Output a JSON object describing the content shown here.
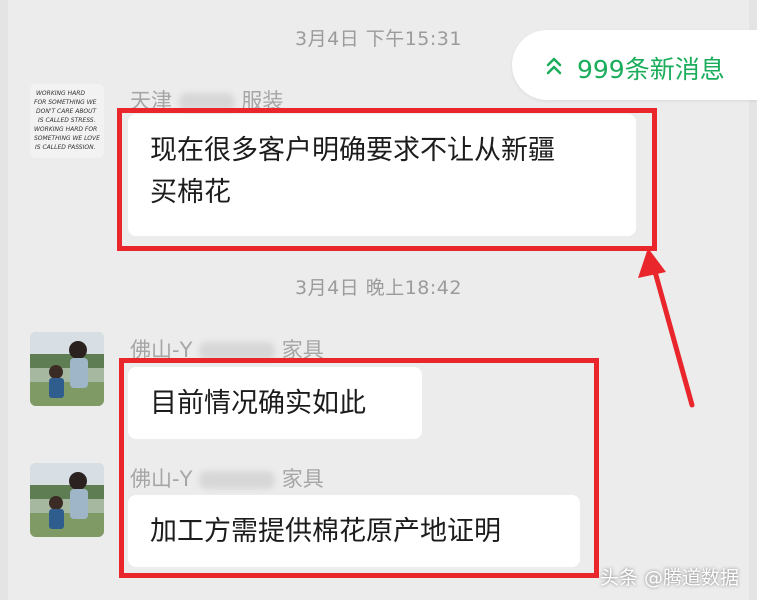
{
  "notification": {
    "new_messages_label": "999条新消息",
    "accent_color": "#1aad5b"
  },
  "messages": [
    {
      "timestamp": "3月4日 下午15:31",
      "sender_prefix": "天津",
      "sender_suffix": "服装",
      "text_line1": "现在很多客户明确要求不让从新疆",
      "text_line2": "买棉花",
      "avatar_lines": [
        "WORKING HARD",
        "FOR SOMETHING WE",
        "DON'T CARE ABOUT",
        "IS CALLED STRESS.",
        "WORKING HARD FOR",
        "SOMETHING WE LOVE",
        "IS CALLED PASSION."
      ]
    },
    {
      "timestamp": "3月4日 晚上18:42",
      "sender_prefix": "佛山-Y",
      "sender_suffix": "家具",
      "text": "目前情况确实如此"
    },
    {
      "sender_prefix": "佛山-Y",
      "sender_suffix": "家具",
      "text": "加工方需提供棉花原产地证明"
    }
  ],
  "annotation": {
    "highlight_color": "#e8262c"
  },
  "watermark": "头条 @腾道数据"
}
